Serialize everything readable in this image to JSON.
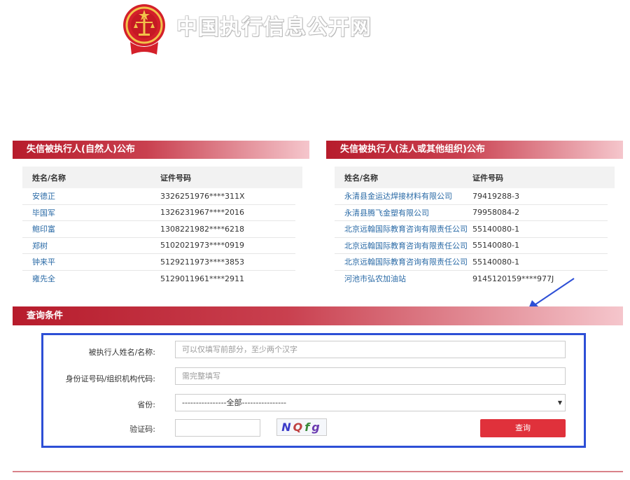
{
  "header": {
    "title": "中国执行信息公开网",
    "emblem_icon": "court-emblem-icon"
  },
  "natural_persons": {
    "title": "失信被执行人(自然人)公布",
    "columns": [
      "姓名/名称",
      "证件号码"
    ],
    "rows": [
      [
        "安德正",
        "3326251976****311X"
      ],
      [
        "毕国军",
        "1326231967****2016"
      ],
      [
        "鲍印富",
        "1308221982****6218"
      ],
      [
        "郑树",
        "5102021973****0919"
      ],
      [
        "钟来平",
        "5129211973****3853"
      ],
      [
        "雍先全",
        "5129011961****2911"
      ]
    ]
  },
  "organizations": {
    "title": "失信被执行人(法人或其他组织)公布",
    "columns": [
      "姓名/名称",
      "证件号码"
    ],
    "rows": [
      [
        "永清县金运达焊接材料有限公司",
        "79419288-3"
      ],
      [
        "永清县腾飞金塑有限公司",
        "79958084-2"
      ],
      [
        "北京远翰国际教育咨询有限责任公司",
        "55140080-1"
      ],
      [
        "北京远翰国际教育咨询有限责任公司",
        "55140080-1"
      ],
      [
        "北京远翰国际教育咨询有限责任公司",
        "55140080-1"
      ],
      [
        "河池市弘农加油站",
        "9145120159****977J"
      ]
    ]
  },
  "query": {
    "title": "查询条件",
    "name_label": "被执行人姓名/名称:",
    "name_placeholder": "可以仅填写前部分，至少两个汉字",
    "id_label": "身份证号码/组织机构代码:",
    "id_placeholder": "需完整填写",
    "province_label": "省份:",
    "province_value": "----------------全部----------------",
    "captcha_label": "验证码:",
    "captcha_chars": [
      "N",
      "Q",
      "f",
      "g"
    ],
    "submit_label": "查询"
  },
  "colors": {
    "accent": "#b71c2c",
    "button": "#e0313b",
    "highlight_box": "#2d4fd6",
    "link": "#2a6aa6"
  }
}
